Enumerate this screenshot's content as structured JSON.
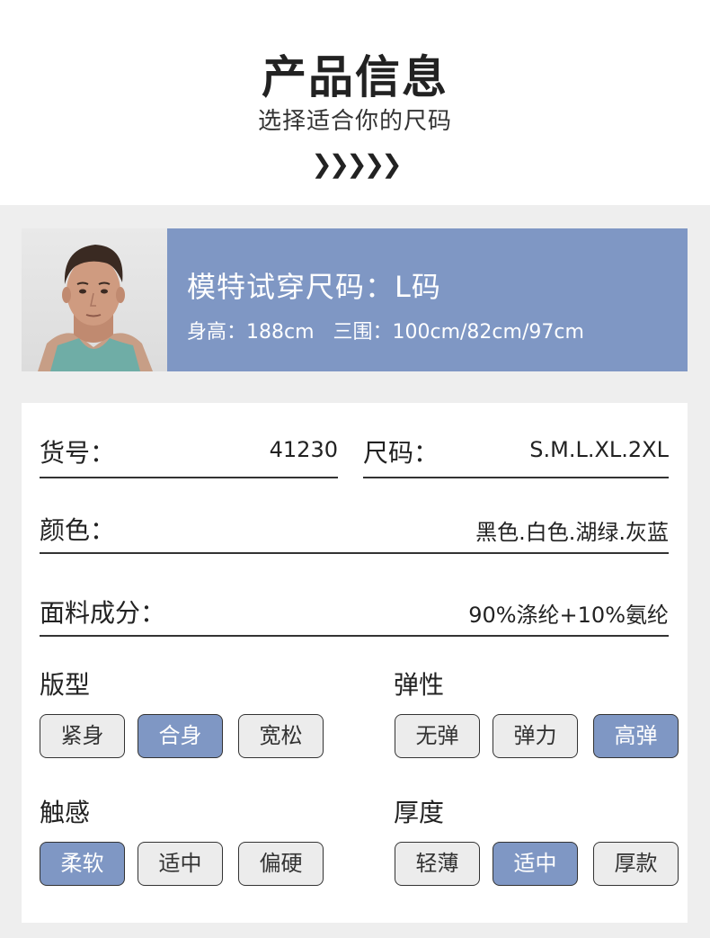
{
  "header": {
    "title": "产品信息",
    "subtitle": "选择适合你的尺码",
    "chevrons": "❯❯❯❯❯"
  },
  "model": {
    "size_text": "模特试穿尺码：L码",
    "measurements": "身高：188cm   三围：100cm/82cm/97cm"
  },
  "fields": {
    "item_no_label": "货号：",
    "item_no_value": "41230",
    "size_label": "尺码：",
    "size_value": "S.M.L.XL.2XL",
    "color_label": "颜色：",
    "color_value": "黑色.白色.湖绿.灰蓝",
    "fabric_label": "面料成分：",
    "fabric_value": "90%涤纶+10%氨纶"
  },
  "groups": {
    "fit": {
      "title": "版型",
      "options": [
        "紧身",
        "合身",
        "宽松"
      ],
      "selected": "合身"
    },
    "elasticity": {
      "title": "弹性",
      "options": [
        "无弹",
        "弹力",
        "高弹"
      ],
      "selected": "高弹"
    },
    "touch": {
      "title": "触感",
      "options": [
        "柔软",
        "适中",
        "偏硬"
      ],
      "selected": "柔软"
    },
    "thickness": {
      "title": "厚度",
      "options": [
        "轻薄",
        "适中",
        "厚款"
      ],
      "selected": "适中"
    }
  },
  "colors": {
    "accent": "#7f97c4",
    "page_gray": "#eeeeee"
  }
}
